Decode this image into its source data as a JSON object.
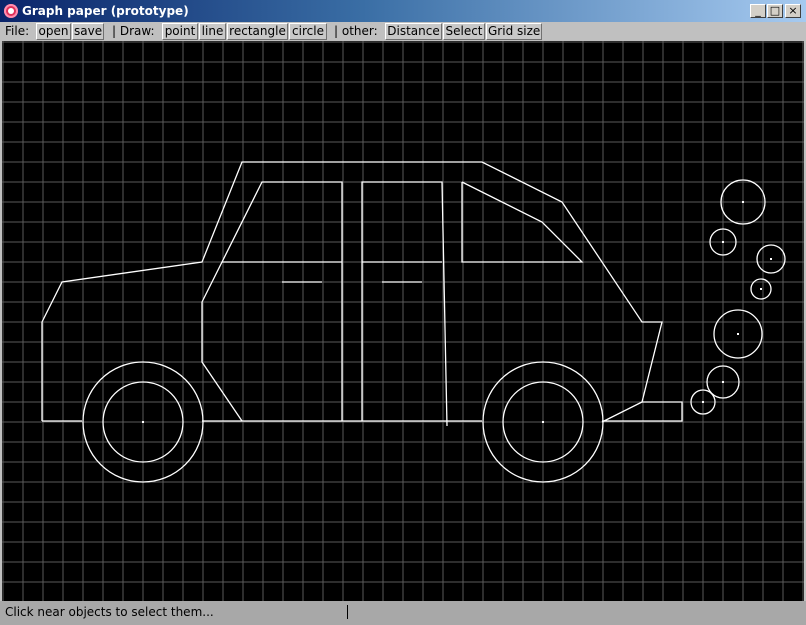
{
  "window": {
    "title": "Graph paper (prototype)",
    "controls": {
      "minimize": "_",
      "maximize": "□",
      "close": "×"
    }
  },
  "toolbar": {
    "file_label": "File:",
    "open_label": "open",
    "save_label": "save",
    "draw_label": "| Draw:",
    "point_label": "point",
    "line_label": "line",
    "rectangle_label": "rectangle",
    "circle_label": "circle",
    "other_label": "| other:",
    "distance_label": "Distance",
    "select_label": "Select",
    "grid_size_label": "Grid size"
  },
  "canvas": {
    "background": "#000000",
    "grid_color": "#5a5a5a",
    "stroke_color": "#ffffff",
    "grid_size": 20
  },
  "statusbar": {
    "text": "Click near objects to select them..."
  },
  "icons": {
    "app_icon": "app-logo-icon"
  }
}
